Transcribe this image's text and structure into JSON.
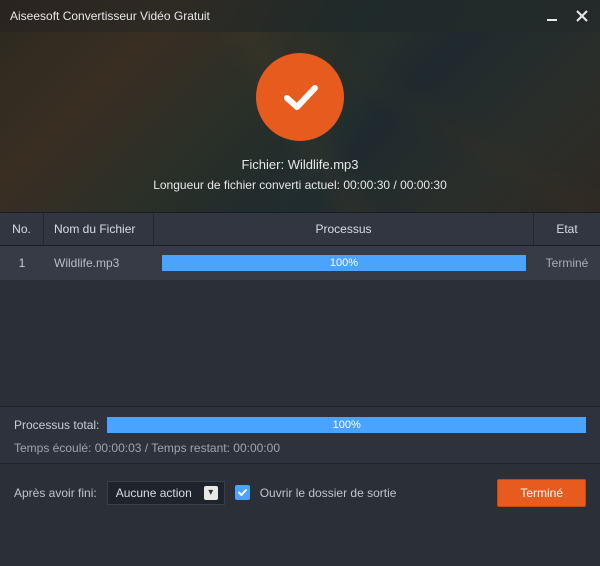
{
  "titlebar": {
    "title": "Aiseesoft Convertisseur Vidéo Gratuit"
  },
  "header": {
    "file_label": "Fichier:",
    "file_name": "Wildlife.mp3",
    "length_prefix": "Longueur de fichier converti actuel:",
    "length_current": "00:00:30",
    "length_total": "00:00:30"
  },
  "columns": {
    "no": "No.",
    "name": "Nom du Fichier",
    "process": "Processus",
    "state": "Etat"
  },
  "rows": [
    {
      "no": "1",
      "name": "Wildlife.mp3",
      "percent": 100,
      "percent_label": "100%",
      "state": "Terminé"
    }
  ],
  "summary": {
    "total_label": "Processus total:",
    "total_percent": 100,
    "total_percent_label": "100%",
    "elapsed_label": "Temps écoulé:",
    "elapsed": "00:00:03",
    "remaining_label": "Temps restant:",
    "remaining": "00:00:00"
  },
  "footer": {
    "after_label": "Après avoir fini:",
    "select_value": "Aucune action",
    "open_folder_checked": true,
    "open_folder_label": "Ouvrir le dossier de sortie",
    "done_button": "Terminé"
  },
  "colors": {
    "accent": "#e85b1f",
    "progress": "#4aa3ff"
  }
}
